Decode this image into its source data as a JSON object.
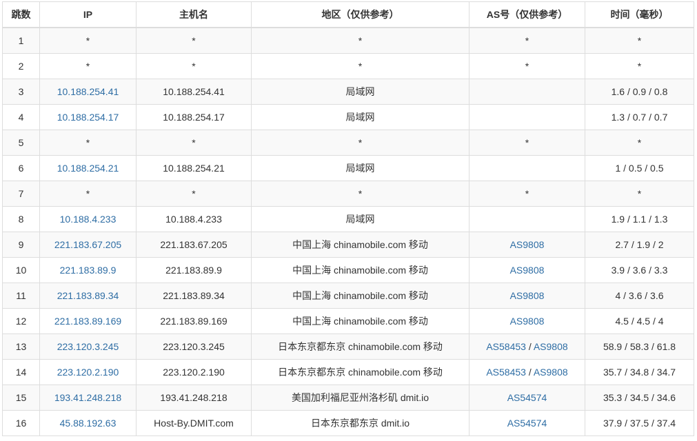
{
  "headers": {
    "hop": "跳数",
    "ip": "IP",
    "hostname": "主机名",
    "region": "地区（仅供参考）",
    "as": "AS号（仅供参考）",
    "time": "时间（毫秒）"
  },
  "as_separator": " / ",
  "rows": [
    {
      "hop": "1",
      "ip": "*",
      "ip_link": false,
      "host": "*",
      "region": "*",
      "as": [
        "*"
      ],
      "as_link": false,
      "time": "*"
    },
    {
      "hop": "2",
      "ip": "*",
      "ip_link": false,
      "host": "*",
      "region": "*",
      "as": [
        "*"
      ],
      "as_link": false,
      "time": "*"
    },
    {
      "hop": "3",
      "ip": "10.188.254.41",
      "ip_link": true,
      "host": "10.188.254.41",
      "region": "局域网",
      "as": [],
      "as_link": true,
      "time": "1.6 / 0.9 / 0.8"
    },
    {
      "hop": "4",
      "ip": "10.188.254.17",
      "ip_link": true,
      "host": "10.188.254.17",
      "region": "局域网",
      "as": [],
      "as_link": true,
      "time": "1.3 / 0.7 / 0.7"
    },
    {
      "hop": "5",
      "ip": "*",
      "ip_link": false,
      "host": "*",
      "region": "*",
      "as": [
        "*"
      ],
      "as_link": false,
      "time": "*"
    },
    {
      "hop": "6",
      "ip": "10.188.254.21",
      "ip_link": true,
      "host": "10.188.254.21",
      "region": "局域网",
      "as": [],
      "as_link": true,
      "time": "1 / 0.5 / 0.5"
    },
    {
      "hop": "7",
      "ip": "*",
      "ip_link": false,
      "host": "*",
      "region": "*",
      "as": [
        "*"
      ],
      "as_link": false,
      "time": "*"
    },
    {
      "hop": "8",
      "ip": "10.188.4.233",
      "ip_link": true,
      "host": "10.188.4.233",
      "region": "局域网",
      "as": [],
      "as_link": true,
      "time": "1.9 / 1.1 / 1.3"
    },
    {
      "hop": "9",
      "ip": "221.183.67.205",
      "ip_link": true,
      "host": "221.183.67.205",
      "region": "中国上海 chinamobile.com 移动",
      "as": [
        "AS9808"
      ],
      "as_link": true,
      "time": "2.7 / 1.9 / 2"
    },
    {
      "hop": "10",
      "ip": "221.183.89.9",
      "ip_link": true,
      "host": "221.183.89.9",
      "region": "中国上海 chinamobile.com 移动",
      "as": [
        "AS9808"
      ],
      "as_link": true,
      "time": "3.9 / 3.6 / 3.3"
    },
    {
      "hop": "11",
      "ip": "221.183.89.34",
      "ip_link": true,
      "host": "221.183.89.34",
      "region": "中国上海 chinamobile.com 移动",
      "as": [
        "AS9808"
      ],
      "as_link": true,
      "time": "4 / 3.6 / 3.6"
    },
    {
      "hop": "12",
      "ip": "221.183.89.169",
      "ip_link": true,
      "host": "221.183.89.169",
      "region": "中国上海 chinamobile.com 移动",
      "as": [
        "AS9808"
      ],
      "as_link": true,
      "time": "4.5 / 4.5 / 4"
    },
    {
      "hop": "13",
      "ip": "223.120.3.245",
      "ip_link": true,
      "host": "223.120.3.245",
      "region": "日本东京都东京 chinamobile.com 移动",
      "as": [
        "AS58453",
        "AS9808"
      ],
      "as_link": true,
      "time": "58.9 / 58.3 / 61.8"
    },
    {
      "hop": "14",
      "ip": "223.120.2.190",
      "ip_link": true,
      "host": "223.120.2.190",
      "region": "日本东京都东京 chinamobile.com 移动",
      "as": [
        "AS58453",
        "AS9808"
      ],
      "as_link": true,
      "time": "35.7 / 34.8 / 34.7"
    },
    {
      "hop": "15",
      "ip": "193.41.248.218",
      "ip_link": true,
      "host": "193.41.248.218",
      "region": "美国加利福尼亚州洛杉矶 dmit.io",
      "as": [
        "AS54574"
      ],
      "as_link": true,
      "time": "35.3 / 34.5 / 34.6"
    },
    {
      "hop": "16",
      "ip": "45.88.192.63",
      "ip_link": true,
      "host": "Host-By.DMIT.com",
      "region": "日本东京都东京 dmit.io",
      "as": [
        "AS54574"
      ],
      "as_link": true,
      "time": "37.9 / 37.5 / 37.4"
    }
  ]
}
